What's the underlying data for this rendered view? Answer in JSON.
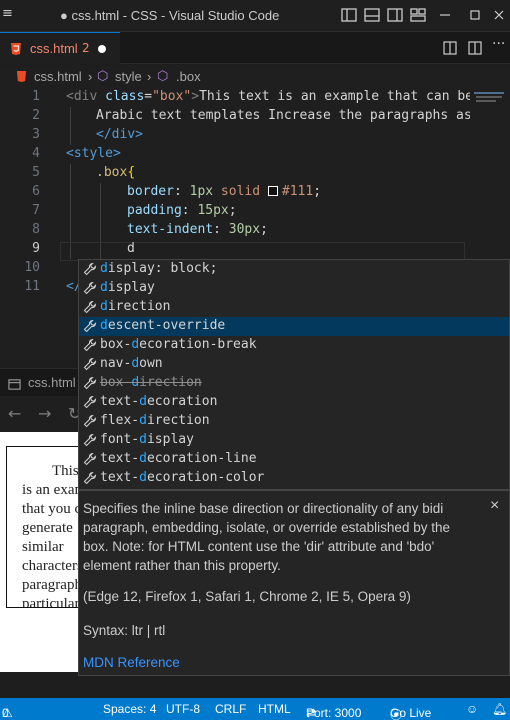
{
  "window": {
    "title": "● css.html - CSS - Visual Studio Code"
  },
  "tab": {
    "name": "css.html",
    "problem_count": "2"
  },
  "breadcrumb": {
    "file": "css.html",
    "sep1": "›",
    "node1": "style",
    "sep2": "›",
    "node2": ".box"
  },
  "editor": {
    "line_numbers": [
      "1",
      "2",
      "3",
      "4",
      "5",
      "6",
      "7",
      "8",
      "9",
      "10",
      "11"
    ],
    "lines": {
      "l1_open": "<div",
      "l1_attr": " class",
      "l1_eq": "=",
      "l1_str": "\"box\"",
      "l1_close": ">",
      "l1_text": "This text is an example that can be",
      "l2_text": "Arabic text templates Increase the paragraphs as",
      "l3_close": "</div>",
      "l4_open": "<style>",
      "l5_sel": ".box",
      "l5_brace": "{",
      "l6_prop": "border",
      "l6_colon": ": ",
      "l6_num": "1px",
      "l6_val": " solid ",
      "l6_color": "#111",
      "l6_semi": ";",
      "l7_prop": "padding",
      "l7_colon": ": ",
      "l7_num": "15px",
      "l7_semi": ";",
      "l8_prop": "text-indent",
      "l8_colon": ": ",
      "l8_num": "30px",
      "l8_semi": ";",
      "l9_typed": "d",
      "l11_text": "</"
    }
  },
  "suggest": {
    "items": [
      {
        "pre": "",
        "match": "d",
        "post": "isplay: block;"
      },
      {
        "pre": "",
        "match": "d",
        "post": "isplay"
      },
      {
        "pre": "",
        "match": "d",
        "post": "irection"
      },
      {
        "pre": "",
        "match": "d",
        "post": "escent-override"
      },
      {
        "pre": "box-",
        "match": "d",
        "post": "ecoration-break"
      },
      {
        "pre": "nav-",
        "match": "d",
        "post": "own"
      },
      {
        "pre": "box-",
        "match": "d",
        "post": "irection"
      },
      {
        "pre": "text-",
        "match": "d",
        "post": "ecoration"
      },
      {
        "pre": "flex-",
        "match": "d",
        "post": "irection"
      },
      {
        "pre": "font-",
        "match": "d",
        "post": "isplay"
      },
      {
        "pre": "text-",
        "match": "d",
        "post": "ecoration-line"
      },
      {
        "pre": "text-",
        "match": "d",
        "post": "ecoration-color"
      }
    ],
    "selected_index": 3,
    "deprecated_index": 6
  },
  "details": {
    "description": "Specifies the inline base direction or directionality of any bidi paragraph, embedding, isolate, or override established by the box. Note: for HTML content use the 'dir' attribute and 'bdo' element rather than this property.",
    "compat": "(Edge 12, Firefox 1, Safari 1, Chrome 2, IE 5, Opera 9)",
    "syntax": "Syntax: ltr | rtl",
    "mdn": "MDN Reference",
    "close": "×"
  },
  "preview": {
    "tab_label": "css.html",
    "text": "This text is an example that you can generate similar characters, paragraph particular design."
  },
  "statusbar": {
    "left": "0",
    "spaces": "Spaces: 4",
    "encoding": "UTF-8",
    "eol": "CRLF",
    "language": "HTML",
    "port": "Port: 3000",
    "golive": "Go Live"
  },
  "colors": {
    "accent": "#007acc",
    "selection": "#04395e",
    "match": "#2aaaff",
    "error": "#f48771"
  },
  "icons": [
    "vscode-menu-icon",
    "layout-icon",
    "panel-icon",
    "sidebar-icon",
    "minimize-icon",
    "maximize-icon",
    "close-icon",
    "html5-icon",
    "split-editor-icon",
    "wrench-icon",
    "bell-icon",
    "feedback-icon"
  ]
}
